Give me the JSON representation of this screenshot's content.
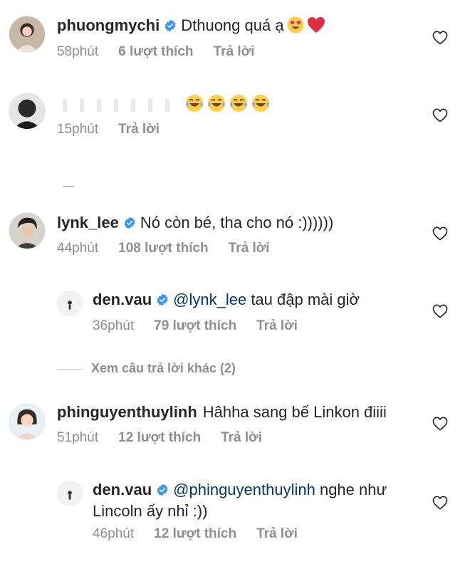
{
  "comments": [
    {
      "username": "phuongmychi",
      "text": "Dthuong quá ạ",
      "time": "58phút",
      "likes": "6 lượt thích",
      "reply": "Trả lời",
      "emojis": [
        "smiling-face-with-heart-eyes",
        "red-heart"
      ]
    },
    {
      "username": "",
      "text": "",
      "time": "15phút",
      "reply": "Trả lời",
      "emojis": [
        "face-with-tears-of-joy",
        "face-with-tears-of-joy",
        "face-with-tears-of-joy",
        "face-with-tears-of-joy"
      ]
    },
    {
      "username": "lynk_lee",
      "text": "Nó còn bé, tha cho nó :))))))",
      "time": "44phút",
      "likes": "108 lượt thích",
      "reply": "Trả lời"
    },
    {
      "username": "den.vau",
      "mention": "@lynk_lee",
      "text": " tau đập mài giờ",
      "time": "36phút",
      "likes": "79 lượt thích",
      "reply": "Trả lời"
    },
    {
      "username": "phinguyenthuylinh",
      "text": "Hâhha sang bế Linkon điiii",
      "time": "51phút",
      "likes": "12 lượt thích",
      "reply": "Trả lời"
    },
    {
      "username": "den.vau",
      "mention": "@phinguyenthuylinh",
      "text_line1": " nghe như",
      "text_line2": "Lincoln ấy nhỉ :))",
      "time": "46phút",
      "likes": "12 lượt thích",
      "reply": "Trả lời"
    }
  ],
  "view_more_replies": "Xem câu trả lời khác (2)",
  "colors": {
    "text": "#262626",
    "meta": "#8e8e8e",
    "verified": "#3897f0",
    "mention": "#00376b"
  },
  "icons": [
    "verified-badge-icon",
    "heart-outline-icon",
    "avatar"
  ]
}
